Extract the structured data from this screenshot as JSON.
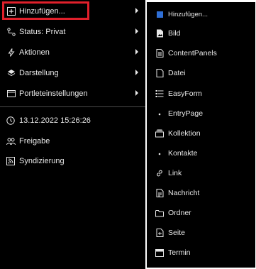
{
  "toolbar": {
    "items": [
      {
        "label": "Hinzufügen...",
        "icon": "plus-square-icon"
      },
      {
        "label": "Status: Privat",
        "icon": "workflow-icon"
      },
      {
        "label": "Aktionen",
        "icon": "lightning-icon"
      },
      {
        "label": "Darstellung",
        "icon": "layers-icon"
      },
      {
        "label": "Portleteinstellungen",
        "icon": "window-icon"
      }
    ],
    "info": [
      {
        "label": "13.12.2022 15:26:26",
        "icon": "clock-icon"
      },
      {
        "label": "Freigabe",
        "icon": "people-icon"
      },
      {
        "label": "Syndizierung",
        "icon": "rss-icon"
      }
    ]
  },
  "submenu": {
    "title": "Hinzufügen...",
    "items": [
      {
        "label": "Bild",
        "icon": "image-file-icon"
      },
      {
        "label": "ContentPanels",
        "icon": "panels-file-icon"
      },
      {
        "label": "Datei",
        "icon": "file-icon"
      },
      {
        "label": "EasyForm",
        "icon": "form-icon"
      },
      {
        "label": "EntryPage",
        "icon": "dot-icon"
      },
      {
        "label": "Kollektion",
        "icon": "collection-icon"
      },
      {
        "label": "Kontakte",
        "icon": "dot-icon"
      },
      {
        "label": "Link",
        "icon": "link-icon"
      },
      {
        "label": "Nachricht",
        "icon": "news-icon"
      },
      {
        "label": "Ordner",
        "icon": "folder-icon"
      },
      {
        "label": "Seite",
        "icon": "page-icon"
      },
      {
        "label": "Termin",
        "icon": "calendar-icon"
      }
    ]
  },
  "colors": {
    "background": "#000000",
    "text": "#e8e8e8",
    "highlight": "#e0202b",
    "accent": "#2f6fd6"
  }
}
